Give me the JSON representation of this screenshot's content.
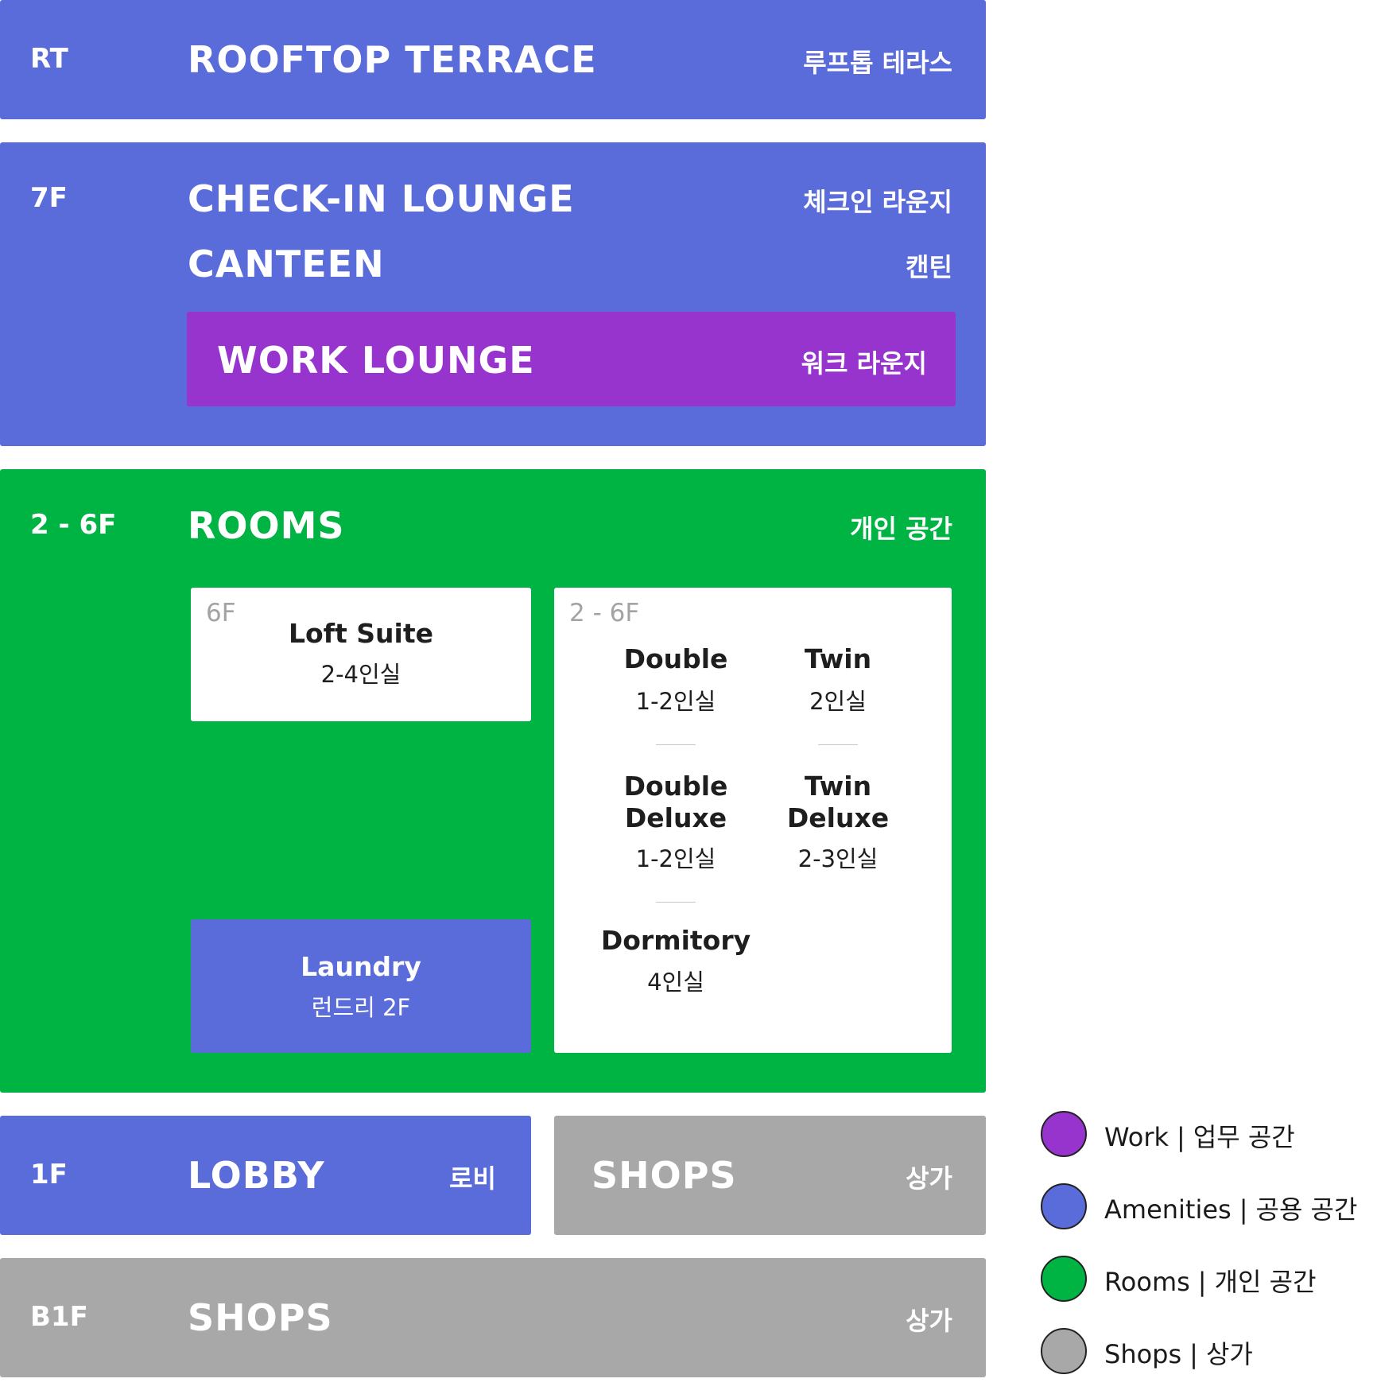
{
  "colors": {
    "amenities": "#5A6BDA",
    "rooms": "#00B444",
    "shops": "#A8A8A8",
    "work": "#9634CD",
    "card": "#FFFFFF"
  },
  "floors": {
    "rt": {
      "code": "RT",
      "name_en": "ROOFTOP TERRACE",
      "name_ko": "루프톱 테라스"
    },
    "f7": {
      "code": "7F",
      "areas": [
        {
          "name_en": "CHECK-IN LOUNGE",
          "name_ko": "체크인 라운지"
        },
        {
          "name_en": "CANTEEN",
          "name_ko": "캔틴"
        }
      ],
      "work": {
        "name_en": "WORK LOUNGE",
        "name_ko": "워크 라운지"
      }
    },
    "rooms": {
      "code": "2 - 6F",
      "name_en": "ROOMS",
      "name_ko": "개인 공간",
      "loft_card": {
        "floor": "6F",
        "name": "Loft Suite",
        "capacity": "2-4인실"
      },
      "laundry": {
        "name": "Laundry",
        "sub": "런드리 2F"
      },
      "rooms_card": {
        "floor": "2 - 6F",
        "types": [
          {
            "name": "Double",
            "capacity": "1-2인실"
          },
          {
            "name": "Twin",
            "capacity": "2인실"
          },
          {
            "name_line1": "Double",
            "name_line2": "Deluxe",
            "capacity": "1-2인실"
          },
          {
            "name_line1": "Twin",
            "name_line2": "Deluxe",
            "capacity": "2-3인실"
          },
          {
            "name": "Dormitory",
            "capacity": "4인실"
          }
        ]
      }
    },
    "f1": {
      "code": "1F",
      "lobby": {
        "name_en": "LOBBY",
        "name_ko": "로비"
      },
      "shops": {
        "name_en": "SHOPS",
        "name_ko": "상가"
      }
    },
    "b1": {
      "code": "B1F",
      "name_en": "SHOPS",
      "name_ko": "상가"
    }
  },
  "legend": [
    {
      "en": "Work",
      "sep": "|",
      "ko": "업무 공간",
      "color": "#9634CD"
    },
    {
      "en": "Amenities",
      "sep": "|",
      "ko": "공용 공간",
      "color": "#5A6BDA"
    },
    {
      "en": "Rooms",
      "sep": "|",
      "ko": "개인 공간",
      "color": "#00B444"
    },
    {
      "en": "Shops",
      "sep": "|",
      "ko": "상가",
      "color": "#A8A8A8"
    }
  ]
}
